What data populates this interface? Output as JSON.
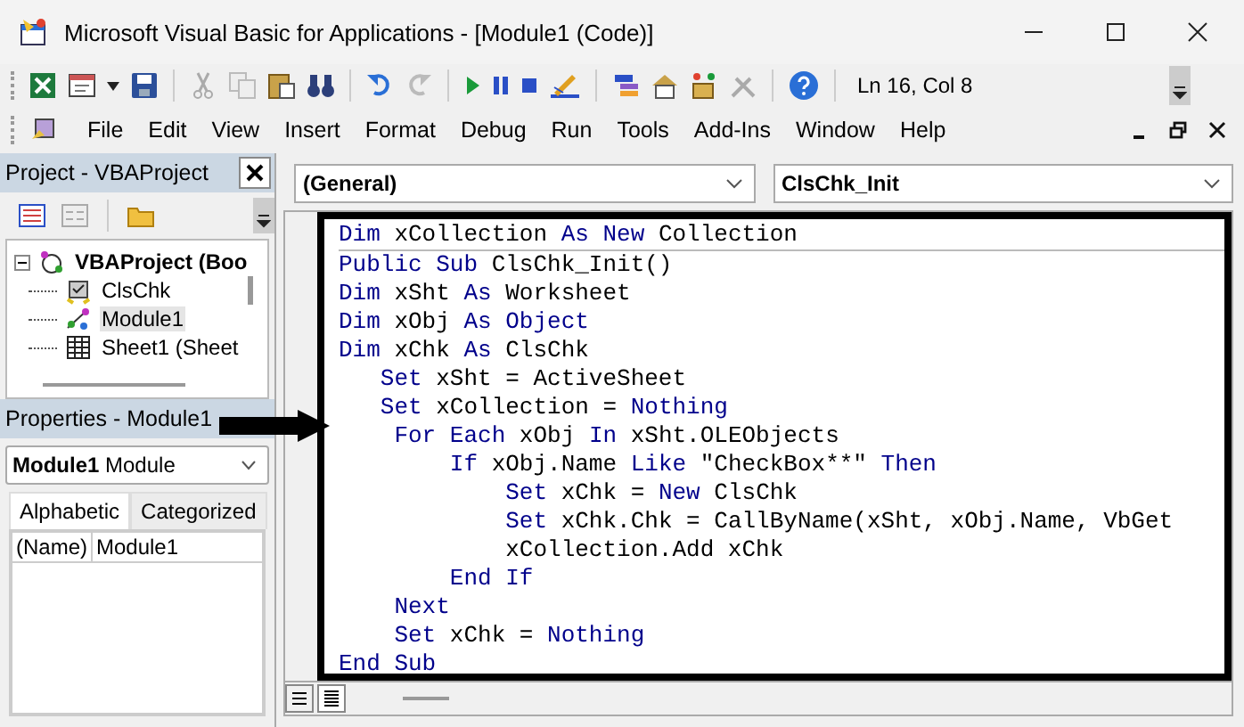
{
  "window": {
    "title": "Microsoft Visual Basic for Applications - [Module1 (Code)]"
  },
  "toolbar": {
    "position": "Ln 16, Col 8"
  },
  "menu": [
    {
      "label": "File"
    },
    {
      "label": "Edit"
    },
    {
      "label": "View"
    },
    {
      "label": "Insert"
    },
    {
      "label": "Format"
    },
    {
      "label": "Debug"
    },
    {
      "label": "Run"
    },
    {
      "label": "Tools"
    },
    {
      "label": "Add-Ins"
    },
    {
      "label": "Window"
    },
    {
      "label": "Help"
    }
  ],
  "project": {
    "title": "Project - VBAProject",
    "tree": [
      {
        "label": "VBAProject (Boo",
        "expanded": true,
        "selected": false,
        "children": [
          {
            "label": "ClsChk",
            "kind": "class",
            "selected": false
          },
          {
            "label": "Module1",
            "kind": "module",
            "selected": true
          },
          {
            "label": "Sheet1 (Sheet",
            "kind": "sheet",
            "selected": false
          }
        ]
      }
    ]
  },
  "properties": {
    "title": "Properties - Module1",
    "object": "**Module1** Module",
    "tabs": [
      {
        "label": "Alphabetic",
        "selected": true
      },
      {
        "label": "Categorized",
        "selected": false
      }
    ],
    "rows": [
      {
        "name": "(Name)",
        "value": "Module1"
      }
    ]
  },
  "code": {
    "object": "(General)",
    "procedure": "ClsChk_Init",
    "lines": [
      {
        "separator": true,
        "tokens": [
          {
            "t": "Dim",
            "kind": "keyword"
          },
          {
            "t": " xCollection ",
            "kind": "plain"
          },
          {
            "t": "As New",
            "kind": "keyword"
          },
          {
            "t": " Collection",
            "kind": "plain"
          }
        ]
      },
      {
        "separator": false,
        "tokens": [
          {
            "t": "Public Sub",
            "kind": "keyword"
          },
          {
            "t": " ClsChk_Init()",
            "kind": "plain"
          }
        ]
      },
      {
        "separator": false,
        "tokens": [
          {
            "t": "Dim",
            "kind": "keyword"
          },
          {
            "t": " xSht ",
            "kind": "plain"
          },
          {
            "t": "As",
            "kind": "keyword"
          },
          {
            "t": " Worksheet",
            "kind": "plain"
          }
        ]
      },
      {
        "separator": false,
        "tokens": [
          {
            "t": "Dim",
            "kind": "keyword"
          },
          {
            "t": " xObj ",
            "kind": "plain"
          },
          {
            "t": "As Object",
            "kind": "keyword"
          }
        ]
      },
      {
        "separator": false,
        "tokens": [
          {
            "t": "Dim",
            "kind": "keyword"
          },
          {
            "t": " xChk ",
            "kind": "plain"
          },
          {
            "t": "As",
            "kind": "keyword"
          },
          {
            "t": " ClsChk",
            "kind": "plain"
          }
        ]
      },
      {
        "separator": false,
        "tokens": [
          {
            "t": "   Set",
            "kind": "keyword"
          },
          {
            "t": " xSht = ActiveSheet",
            "kind": "plain"
          }
        ]
      },
      {
        "separator": false,
        "tokens": [
          {
            "t": "   Set",
            "kind": "keyword"
          },
          {
            "t": " xCollection = ",
            "kind": "plain"
          },
          {
            "t": "Nothing",
            "kind": "keyword"
          }
        ]
      },
      {
        "separator": false,
        "tokens": [
          {
            "t": "    For Each",
            "kind": "keyword"
          },
          {
            "t": " xObj ",
            "kind": "plain"
          },
          {
            "t": "In",
            "kind": "keyword"
          },
          {
            "t": " xSht.OLEObjects",
            "kind": "plain"
          }
        ]
      },
      {
        "separator": false,
        "tokens": [
          {
            "t": "        If",
            "kind": "keyword"
          },
          {
            "t": " xObj.Name ",
            "kind": "plain"
          },
          {
            "t": "Like",
            "kind": "keyword"
          },
          {
            "t": " \"CheckBox**\" ",
            "kind": "plain"
          },
          {
            "t": "Then",
            "kind": "keyword"
          }
        ]
      },
      {
        "separator": false,
        "tokens": [
          {
            "t": "            Set",
            "kind": "keyword"
          },
          {
            "t": " xChk = ",
            "kind": "plain"
          },
          {
            "t": "New",
            "kind": "keyword"
          },
          {
            "t": " ClsChk",
            "kind": "plain"
          }
        ]
      },
      {
        "separator": false,
        "tokens": [
          {
            "t": "            Set",
            "kind": "keyword"
          },
          {
            "t": " xChk.Chk = CallByName(xSht, xObj.Name, VbGet",
            "kind": "plain"
          }
        ]
      },
      {
        "separator": false,
        "tokens": [
          {
            "t": "            xCollection.Add xChk",
            "kind": "plain"
          }
        ]
      },
      {
        "separator": false,
        "tokens": [
          {
            "t": "        End If",
            "kind": "keyword"
          }
        ]
      },
      {
        "separator": false,
        "tokens": [
          {
            "t": "    Next",
            "kind": "keyword"
          }
        ]
      },
      {
        "separator": false,
        "tokens": [
          {
            "t": "    Set",
            "kind": "keyword"
          },
          {
            "t": " xChk = ",
            "kind": "plain"
          },
          {
            "t": "Nothing",
            "kind": "keyword"
          }
        ]
      },
      {
        "separator": false,
        "tokens": [
          {
            "t": "End Sub",
            "kind": "keyword"
          }
        ]
      }
    ]
  }
}
